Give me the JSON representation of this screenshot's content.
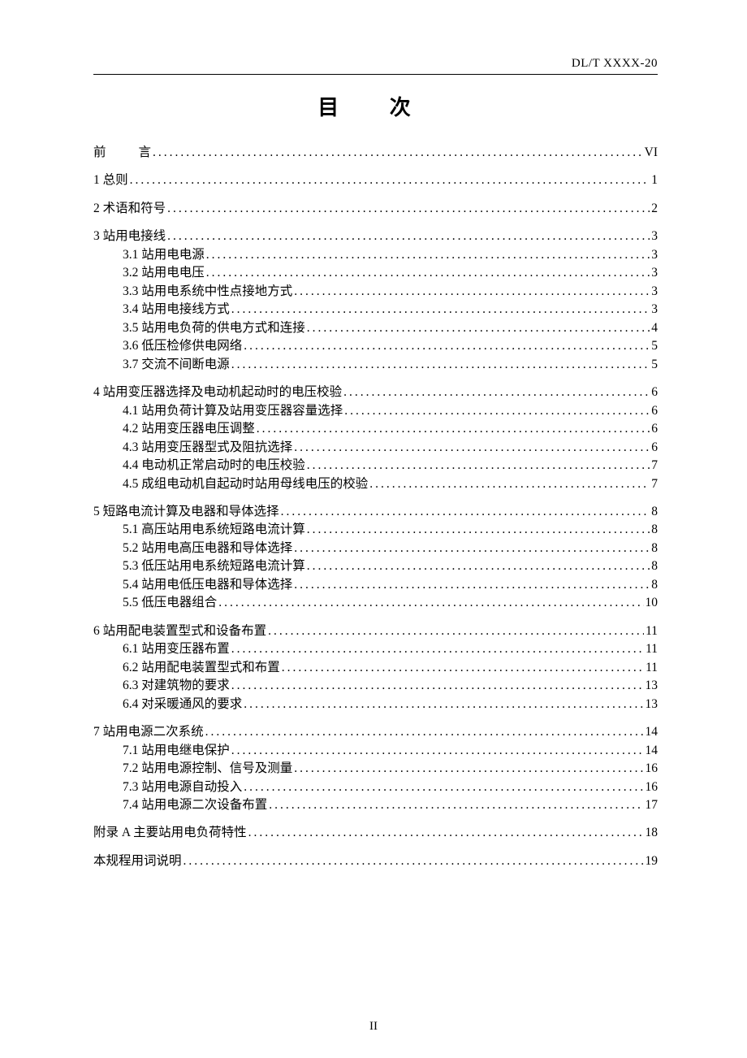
{
  "header": "DL/T XXXX-20",
  "title": "目    次",
  "page_footer": "II",
  "toc": [
    {
      "type": "block",
      "items": [
        {
          "label_l": "前",
          "label_r": "言",
          "page": "VI",
          "preface": true
        }
      ]
    },
    {
      "type": "block",
      "items": [
        {
          "label": "1  总则",
          "page": "1"
        }
      ]
    },
    {
      "type": "block",
      "items": [
        {
          "label": "2  术语和符号",
          "page": "2"
        }
      ]
    },
    {
      "type": "block",
      "items": [
        {
          "label": "3  站用电接线",
          "page": "3"
        },
        {
          "label": "3.1  站用电电源",
          "page": "3",
          "sub": true
        },
        {
          "label": "3.2  站用电电压",
          "page": "3",
          "sub": true
        },
        {
          "label": "3.3  站用电系统中性点接地方式",
          "page": "3",
          "sub": true
        },
        {
          "label": "3.4  站用电接线方式",
          "page": "3",
          "sub": true
        },
        {
          "label": "3.5  站用电负荷的供电方式和连接",
          "page": "4",
          "sub": true
        },
        {
          "label": "3.6 低压检修供电网络",
          "page": "5",
          "sub": true
        },
        {
          "label": "3.7  交流不间断电源",
          "page": "5",
          "sub": true
        }
      ]
    },
    {
      "type": "block",
      "items": [
        {
          "label": "4  站用变压器选择及电动机起动时的电压校验",
          "page": "6"
        },
        {
          "label": "4.1  站用负荷计算及站用变压器容量选择",
          "page": "6",
          "sub": true
        },
        {
          "label": "4.2  站用变压器电压调整",
          "page": "6",
          "sub": true
        },
        {
          "label": "4.3 站用变压器型式及阻抗选择",
          "page": "6",
          "sub": true
        },
        {
          "label": "4.4  电动机正常启动时的电压校验",
          "page": "7",
          "sub": true
        },
        {
          "label": "4.5  成组电动机自起动时站用母线电压的校验",
          "page": "7",
          "sub": true
        }
      ]
    },
    {
      "type": "block",
      "items": [
        {
          "label": "5  短路电流计算及电器和导体选择",
          "page": "8"
        },
        {
          "label": "5.1  高压站用电系统短路电流计算",
          "page": "8",
          "sub": true
        },
        {
          "label": "5.2  站用电高压电器和导体选择",
          "page": "8",
          "sub": true
        },
        {
          "label": "5.3  低压站用电系统短路电流计算",
          "page": "8",
          "sub": true
        },
        {
          "label": "5.4  站用电低压电器和导体选择",
          "page": "8",
          "sub": true
        },
        {
          "label": "5.5  低压电器组合",
          "page": "10",
          "sub": true
        }
      ]
    },
    {
      "type": "block",
      "items": [
        {
          "label": "6  站用配电装置型式和设备布置",
          "page": "11"
        },
        {
          "label": "6.1 站用变压器布置",
          "page": "11",
          "sub": true
        },
        {
          "label": "6.2  站用配电装置型式和布置",
          "page": "11",
          "sub": true
        },
        {
          "label": "6.3  对建筑物的要求",
          "page": "13",
          "sub": true
        },
        {
          "label": "6.4  对采暖通风的要求",
          "page": "13",
          "sub": true
        }
      ]
    },
    {
      "type": "block",
      "items": [
        {
          "label": "7  站用电源二次系统",
          "page": "14"
        },
        {
          "label": "7.1  站用电继电保护",
          "page": "14",
          "sub": true
        },
        {
          "label": "7.2  站用电源控制、信号及测量",
          "page": "16",
          "sub": true
        },
        {
          "label": "7.3  站用电源自动投入",
          "page": "16",
          "sub": true
        },
        {
          "label": "7.4  站用电源二次设备布置",
          "page": "17",
          "sub": true
        }
      ]
    },
    {
      "type": "block",
      "items": [
        {
          "label": "附录 A  主要站用电负荷特性",
          "page": "18"
        }
      ]
    },
    {
      "type": "block",
      "items": [
        {
          "label": "本规程用词说明",
          "page": "19"
        }
      ]
    }
  ]
}
